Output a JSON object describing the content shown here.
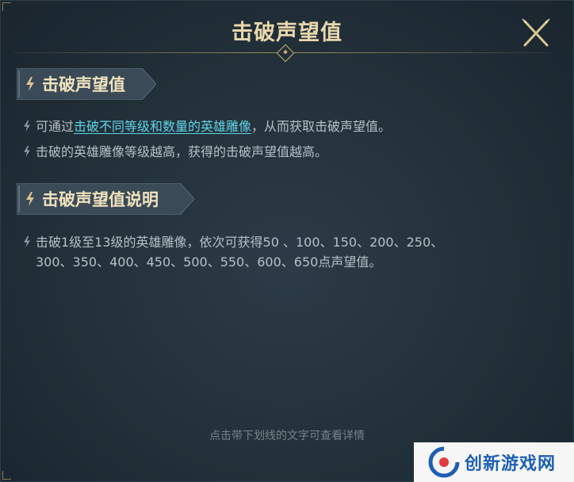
{
  "dialog": {
    "title": "击破声望值",
    "footer_hint": "点击带下划线的文字可查看详情"
  },
  "section1": {
    "label": "击破声望值",
    "line1": {
      "prefix": "可通过",
      "link": "击破不同等级和数量的英雄雕像",
      "suffix": "，从而获取击破声望值。"
    },
    "line2": "击破的英雄雕像等级越高，获得的击破声望值越高。"
  },
  "section2": {
    "label": "击破声望值说明",
    "line1": "击破1级至13级的英雄雕像，依次可获得50 、100、150、200、250、",
    "line2": "300、350、400、450、500、550、600、650点声望值。"
  },
  "watermark": {
    "text": "创新游戏网"
  },
  "colors": {
    "title": "#e8d7ad",
    "link": "#5fd4e8",
    "body_text": "#b6c0c6",
    "gold_accent": "#c7ae78"
  },
  "icons": [
    "close-icon",
    "bolt-icon",
    "diamond-ornament-icon",
    "watermark-logo-icon"
  ]
}
